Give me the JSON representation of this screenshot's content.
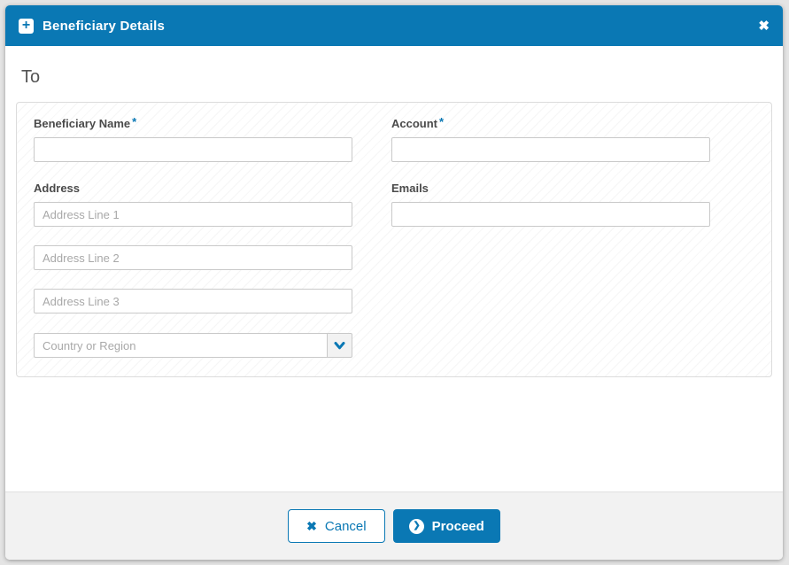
{
  "header": {
    "title": "Beneficiary Details",
    "plus_icon": "+",
    "close_icon": "✖"
  },
  "section": {
    "heading": "To"
  },
  "form": {
    "required_marker": "*",
    "beneficiary_name": {
      "label": "Beneficiary Name",
      "value": "",
      "placeholder": ""
    },
    "account": {
      "label": "Account",
      "value": "",
      "placeholder": ""
    },
    "address": {
      "label": "Address",
      "line1": {
        "value": "",
        "placeholder": "Address Line 1"
      },
      "line2": {
        "value": "",
        "placeholder": "Address Line 2"
      },
      "line3": {
        "value": "",
        "placeholder": "Address Line 3"
      },
      "country": {
        "selected_value": "",
        "placeholder": "Country or Region"
      }
    },
    "emails": {
      "label": "Emails",
      "value": "",
      "placeholder": ""
    }
  },
  "footer": {
    "cancel": {
      "label": "Cancel",
      "icon": "✖"
    },
    "proceed": {
      "label": "Proceed",
      "icon": "❯"
    }
  },
  "colors": {
    "accent_blue": "#0a78b4",
    "footer_gray": "#f2f2f2",
    "page_background": "#e4e4e4"
  }
}
